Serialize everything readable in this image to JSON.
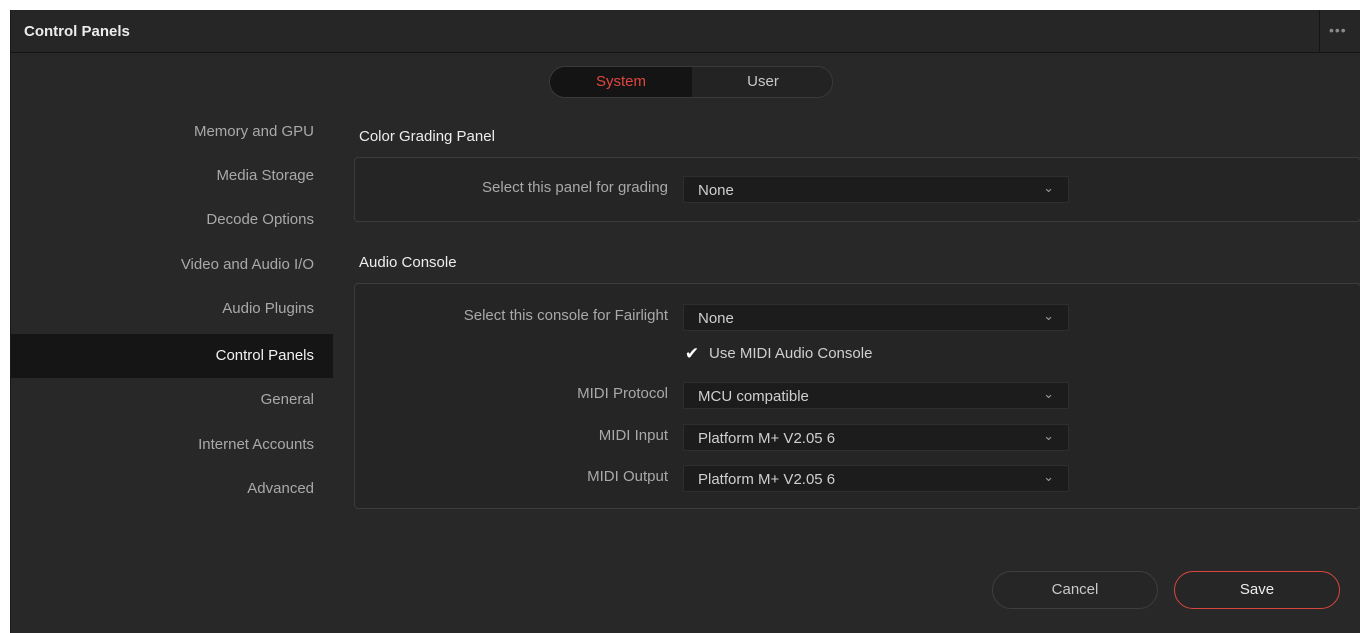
{
  "window": {
    "title": "Control Panels",
    "more_label": "•••"
  },
  "tabs": {
    "system": "System",
    "user": "User",
    "active": "System",
    "accent": "#e0463f"
  },
  "sidebar": {
    "items": [
      {
        "label": "Memory and GPU"
      },
      {
        "label": "Media Storage"
      },
      {
        "label": "Decode Options"
      },
      {
        "label": "Video and Audio I/O"
      },
      {
        "label": "Audio Plugins"
      },
      {
        "label": "Control Panels",
        "active": true
      },
      {
        "label": "General"
      },
      {
        "label": "Internet Accounts"
      },
      {
        "label": "Advanced"
      }
    ]
  },
  "color_grading": {
    "title": "Color Grading Panel",
    "select_label": "Select this panel for grading",
    "select_value": "None"
  },
  "audio_console": {
    "title": "Audio Console",
    "console_label": "Select this console for Fairlight",
    "console_value": "None",
    "use_midi_label": "Use MIDI Audio Console",
    "use_midi_checked": true,
    "protocol_label": "MIDI Protocol",
    "protocol_value": "MCU compatible",
    "input_label": "MIDI Input",
    "input_value": "Platform M+ V2.05 6",
    "output_label": "MIDI Output",
    "output_value": "Platform M+ V2.05 6"
  },
  "footer": {
    "cancel_label": "Cancel",
    "save_label": "Save"
  },
  "icons": {
    "chevron": "chevron-down-icon",
    "check": "checkmark-icon",
    "more": "more-dots-icon"
  }
}
